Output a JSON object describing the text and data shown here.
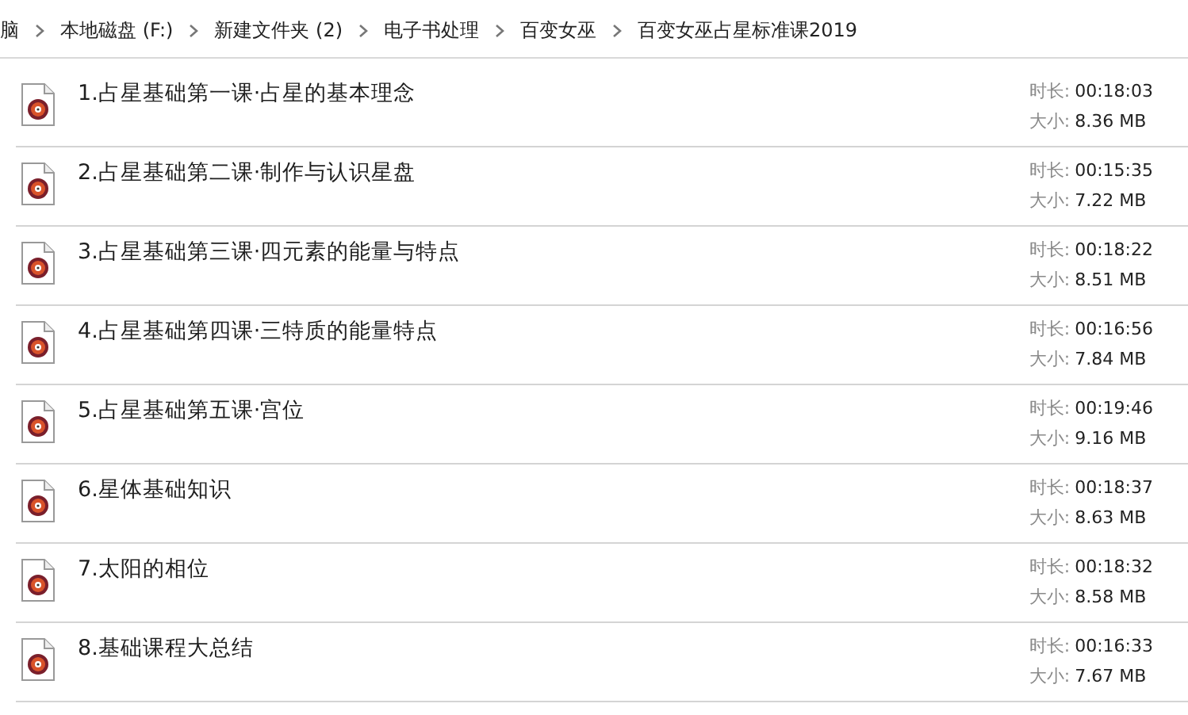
{
  "breadcrumb": [
    "脑",
    "本地磁盘 (F:)",
    "新建文件夹 (2)",
    "电子书处理",
    "百变女巫",
    "百变女巫占星标准课2019"
  ],
  "files": [
    {
      "name": "1.占星基础第一课·占星的基本理念",
      "duration_label": "时长:",
      "duration": "00:18:03",
      "size_label": "大小:",
      "size": "8.36 MB"
    },
    {
      "name": "2.占星基础第二课·制作与认识星盘",
      "duration_label": "时长:",
      "duration": "00:15:35",
      "size_label": "大小:",
      "size": "7.22 MB"
    },
    {
      "name": "3.占星基础第三课·四元素的能量与特点",
      "duration_label": "时长:",
      "duration": "00:18:22",
      "size_label": "大小:",
      "size": "8.51 MB"
    },
    {
      "name": "4.占星基础第四课·三特质的能量特点",
      "duration_label": "时长:",
      "duration": "00:16:56",
      "size_label": "大小:",
      "size": "7.84 MB"
    },
    {
      "name": "5.占星基础第五课·宫位",
      "duration_label": "时长:",
      "duration": "00:19:46",
      "size_label": "大小:",
      "size": "9.16 MB"
    },
    {
      "name": "6.星体基础知识",
      "duration_label": "时长:",
      "duration": "00:18:37",
      "size_label": "大小:",
      "size": "8.63 MB"
    },
    {
      "name": "7.太阳的相位",
      "duration_label": "时长:",
      "duration": "00:18:32",
      "size_label": "大小:",
      "size": "8.58 MB"
    },
    {
      "name": "8.基础课程大总结",
      "duration_label": "时长:",
      "duration": "00:16:33",
      "size_label": "大小:",
      "size": "7.67 MB"
    }
  ]
}
